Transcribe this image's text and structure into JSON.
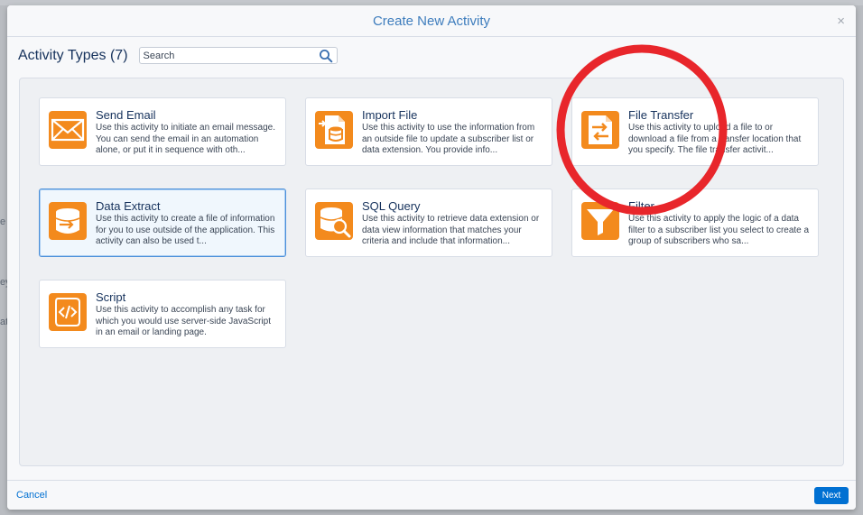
{
  "background": {
    "fragments": [
      "e",
      "ey",
      "at"
    ]
  },
  "modal": {
    "title": "Create New Activity",
    "close_glyph": "×"
  },
  "toolbar": {
    "heading": "Activity Types (7)",
    "search_placeholder": "Search",
    "search_value": ""
  },
  "activities": [
    {
      "title": "Send Email",
      "description": "Use this activity to initiate an email message. You can send the email in an automation alone, or put it in sequence with oth...",
      "icon": "envelope-icon"
    },
    {
      "title": "Import File",
      "description": "Use this activity to use the information from an outside file to update a subscriber list or data extension. You provide info...",
      "icon": "import-file-icon"
    },
    {
      "title": "File Transfer",
      "description": "Use this activity to upload a file to or download a file from a transfer location that you specify. The file transfer activit...",
      "icon": "file-transfer-icon"
    },
    {
      "title": "Data Extract",
      "description": "Use this activity to create a file of information for you to use outside of the application. This activity can also be used t...",
      "icon": "data-extract-icon",
      "selected": true
    },
    {
      "title": "SQL Query",
      "description": "Use this activity to retrieve data extension or data view information that matches your criteria and include that information...",
      "icon": "sql-query-icon"
    },
    {
      "title": "Filter",
      "description": "Use this activity to apply the logic of a data filter to a subscriber list you select to create a group of subscribers who sa...",
      "icon": "filter-funnel-icon"
    },
    {
      "title": "Script",
      "description": "Use this activity to accomplish any task for which you would use server-side JavaScript in an email or landing page.",
      "icon": "script-icon"
    }
  ],
  "footer": {
    "cancel_label": "Cancel",
    "next_label": "Next"
  },
  "colors": {
    "icon_orange": "#f38a1d",
    "primary_blue": "#0070d2",
    "title_blue": "#3e7dbd",
    "annotation_red": "#e8262b",
    "selected_border": "#4b8fd9"
  }
}
